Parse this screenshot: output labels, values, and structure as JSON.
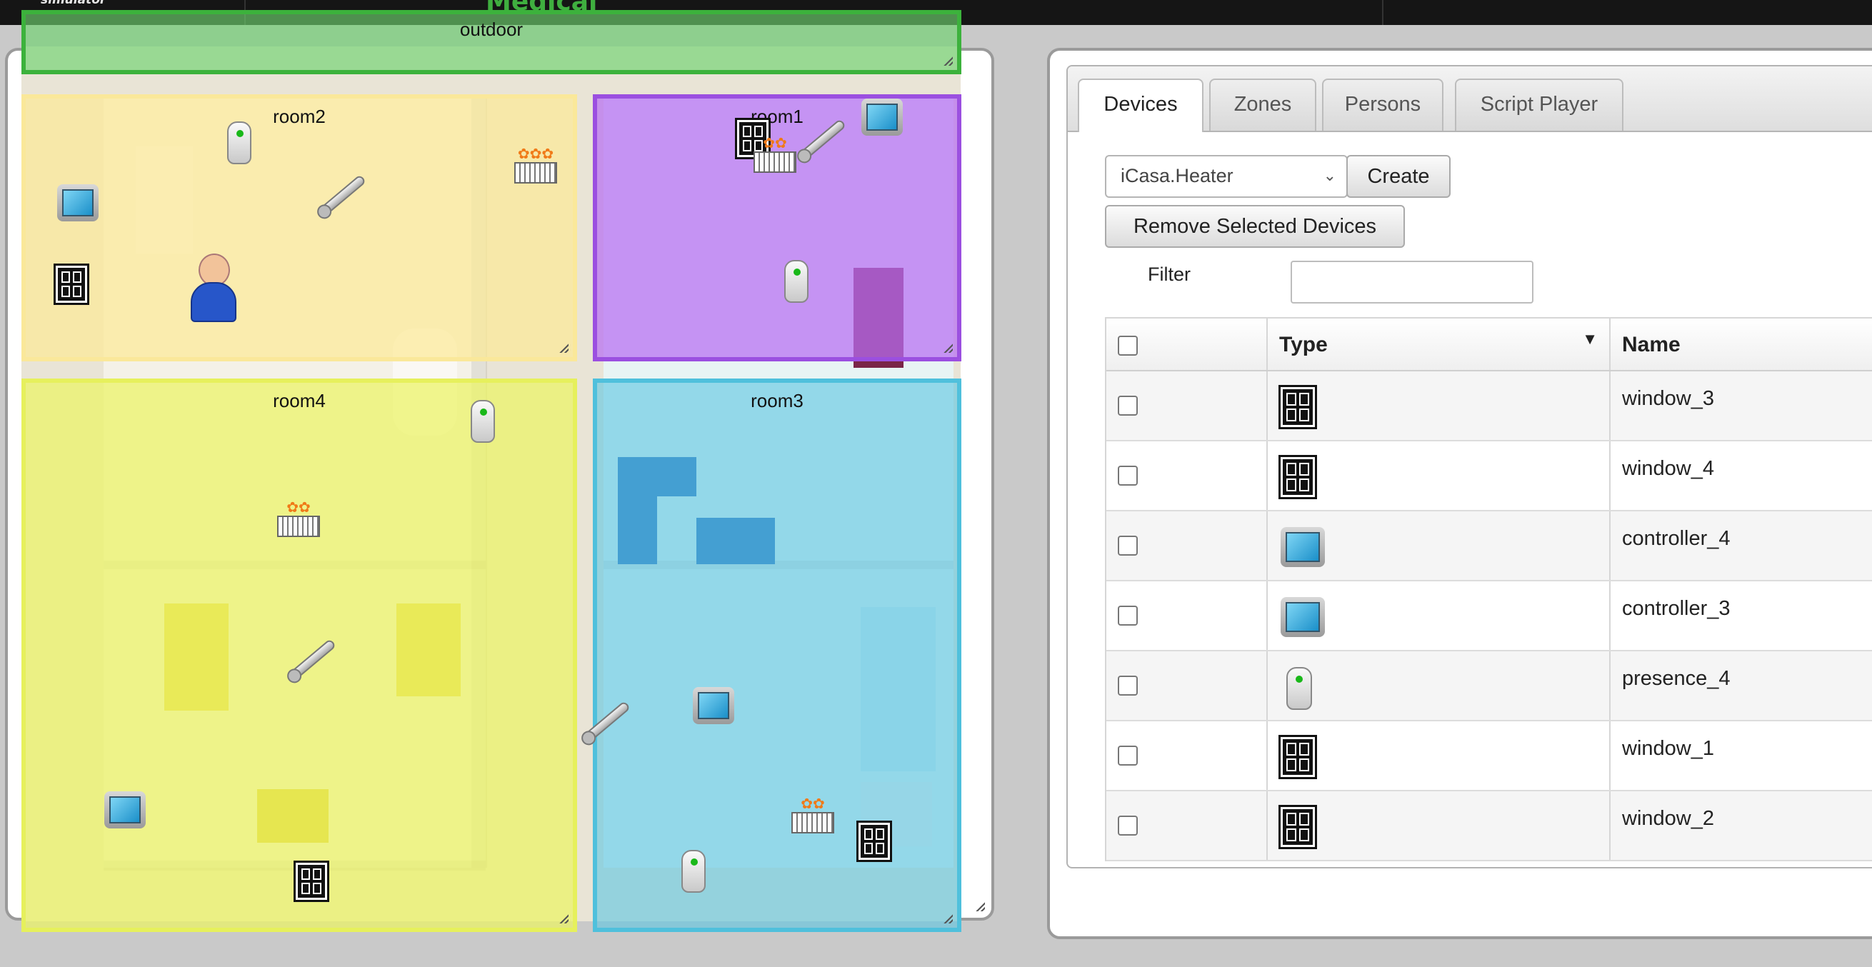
{
  "topbar": {
    "brand": "simulator",
    "brand2": "Medical"
  },
  "zones": {
    "outdoor": "outdoor",
    "room1": "room1",
    "room2": "room2",
    "room3": "room3",
    "room4": "room4"
  },
  "tabs": [
    {
      "label": "Devices",
      "active": true
    },
    {
      "label": "Zones",
      "active": false
    },
    {
      "label": "Persons",
      "active": false
    },
    {
      "label": "Script Player",
      "active": false
    }
  ],
  "toolbar": {
    "device_type": "iCasa.Heater",
    "create_label": "Create",
    "remove_label": "Remove Selected Devices",
    "filter_label": "Filter",
    "filter_value": ""
  },
  "table": {
    "headers": {
      "type": "Type",
      "name": "Name"
    },
    "rows": [
      {
        "icon": "window-icon",
        "name": "window_3"
      },
      {
        "icon": "window-icon",
        "name": "window_4"
      },
      {
        "icon": "controller-icon",
        "name": "controller_4"
      },
      {
        "icon": "controller-icon",
        "name": "controller_3"
      },
      {
        "icon": "presence-sensor-icon",
        "name": "presence_4"
      },
      {
        "icon": "window-icon",
        "name": "window_1"
      },
      {
        "icon": "window-icon",
        "name": "window_2"
      }
    ]
  },
  "colors": {
    "outdoor": "#6cd16c",
    "room1": "#b76cf2",
    "room2": "#fbe9a1",
    "room3": "#5fc8e3",
    "room4": "#eef56e"
  }
}
